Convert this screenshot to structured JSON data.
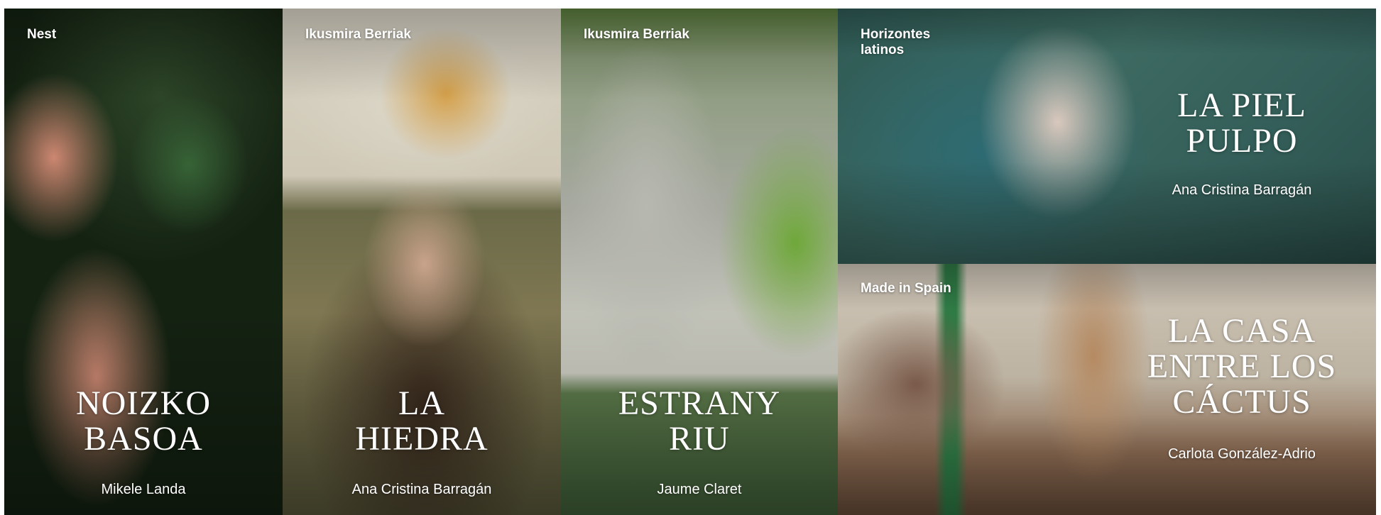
{
  "films": [
    {
      "section": "Nest",
      "title_line1": "NOIZKO",
      "title_line2": "BASOA",
      "director": "Mikele Landa"
    },
    {
      "section": "Ikusmira Berriak",
      "title_line1": "LA",
      "title_line2": "HIEDRA",
      "director": "Ana Cristina Barragán"
    },
    {
      "section": "Ikusmira Berriak",
      "title_line1": "ESTRANY",
      "title_line2": "RIU",
      "director": "Jaume Claret"
    },
    {
      "section": "Horizontes latinos",
      "title_line1": "LA PIEL",
      "title_line2": "PULPO",
      "director": "Ana Cristina Barragán"
    },
    {
      "section": "Made in Spain",
      "title_line1": "LA CASA",
      "title_line2": "ENTRE LOS",
      "title_line3": "CÁCTUS",
      "director": "Carlota González-Adrio"
    }
  ]
}
